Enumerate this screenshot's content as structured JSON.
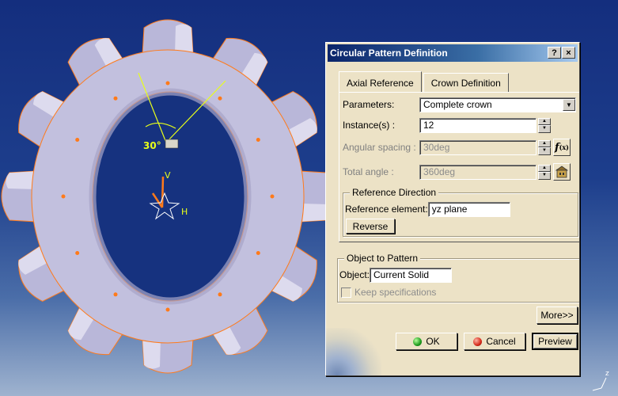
{
  "dialog": {
    "title": "Circular Pattern Definition",
    "help_label": "?",
    "close_label": "×",
    "tabs": [
      {
        "label": "Axial Reference",
        "active": true
      },
      {
        "label": "Crown Definition",
        "active": false
      }
    ],
    "parameters": {
      "label": "Parameters:",
      "value": "Complete crown"
    },
    "instances": {
      "label": "Instance(s) :",
      "value": "12"
    },
    "angular_spacing": {
      "label": "Angular spacing :",
      "value": "30deg",
      "disabled": true
    },
    "total_angle": {
      "label": "Total angle :",
      "value": "360deg",
      "disabled": true
    },
    "reference_direction": {
      "legend": "Reference Direction",
      "element_label": "Reference element:",
      "element_value": "yz plane",
      "reverse_label": "Reverse"
    },
    "object_to_pattern": {
      "legend": "Object to Pattern",
      "object_label": "Object:",
      "object_value": "Current Solid",
      "keep_specs_label": "Keep specifications",
      "keep_specs_checked": false
    },
    "more_label": "More>>",
    "ok_label": "OK",
    "cancel_label": "Cancel",
    "preview_label": "Preview"
  },
  "viewport": {
    "angle_label": "30°",
    "axis_labels": {
      "v": "V",
      "h": "H",
      "z": "z"
    }
  },
  "colors": {
    "background_top": "#142e7e",
    "part_face": "#b9b7d9",
    "edge_highlight": "#ff7a1a",
    "dialog_bg": "#ece2c6",
    "titlebar": "#0a246a"
  }
}
